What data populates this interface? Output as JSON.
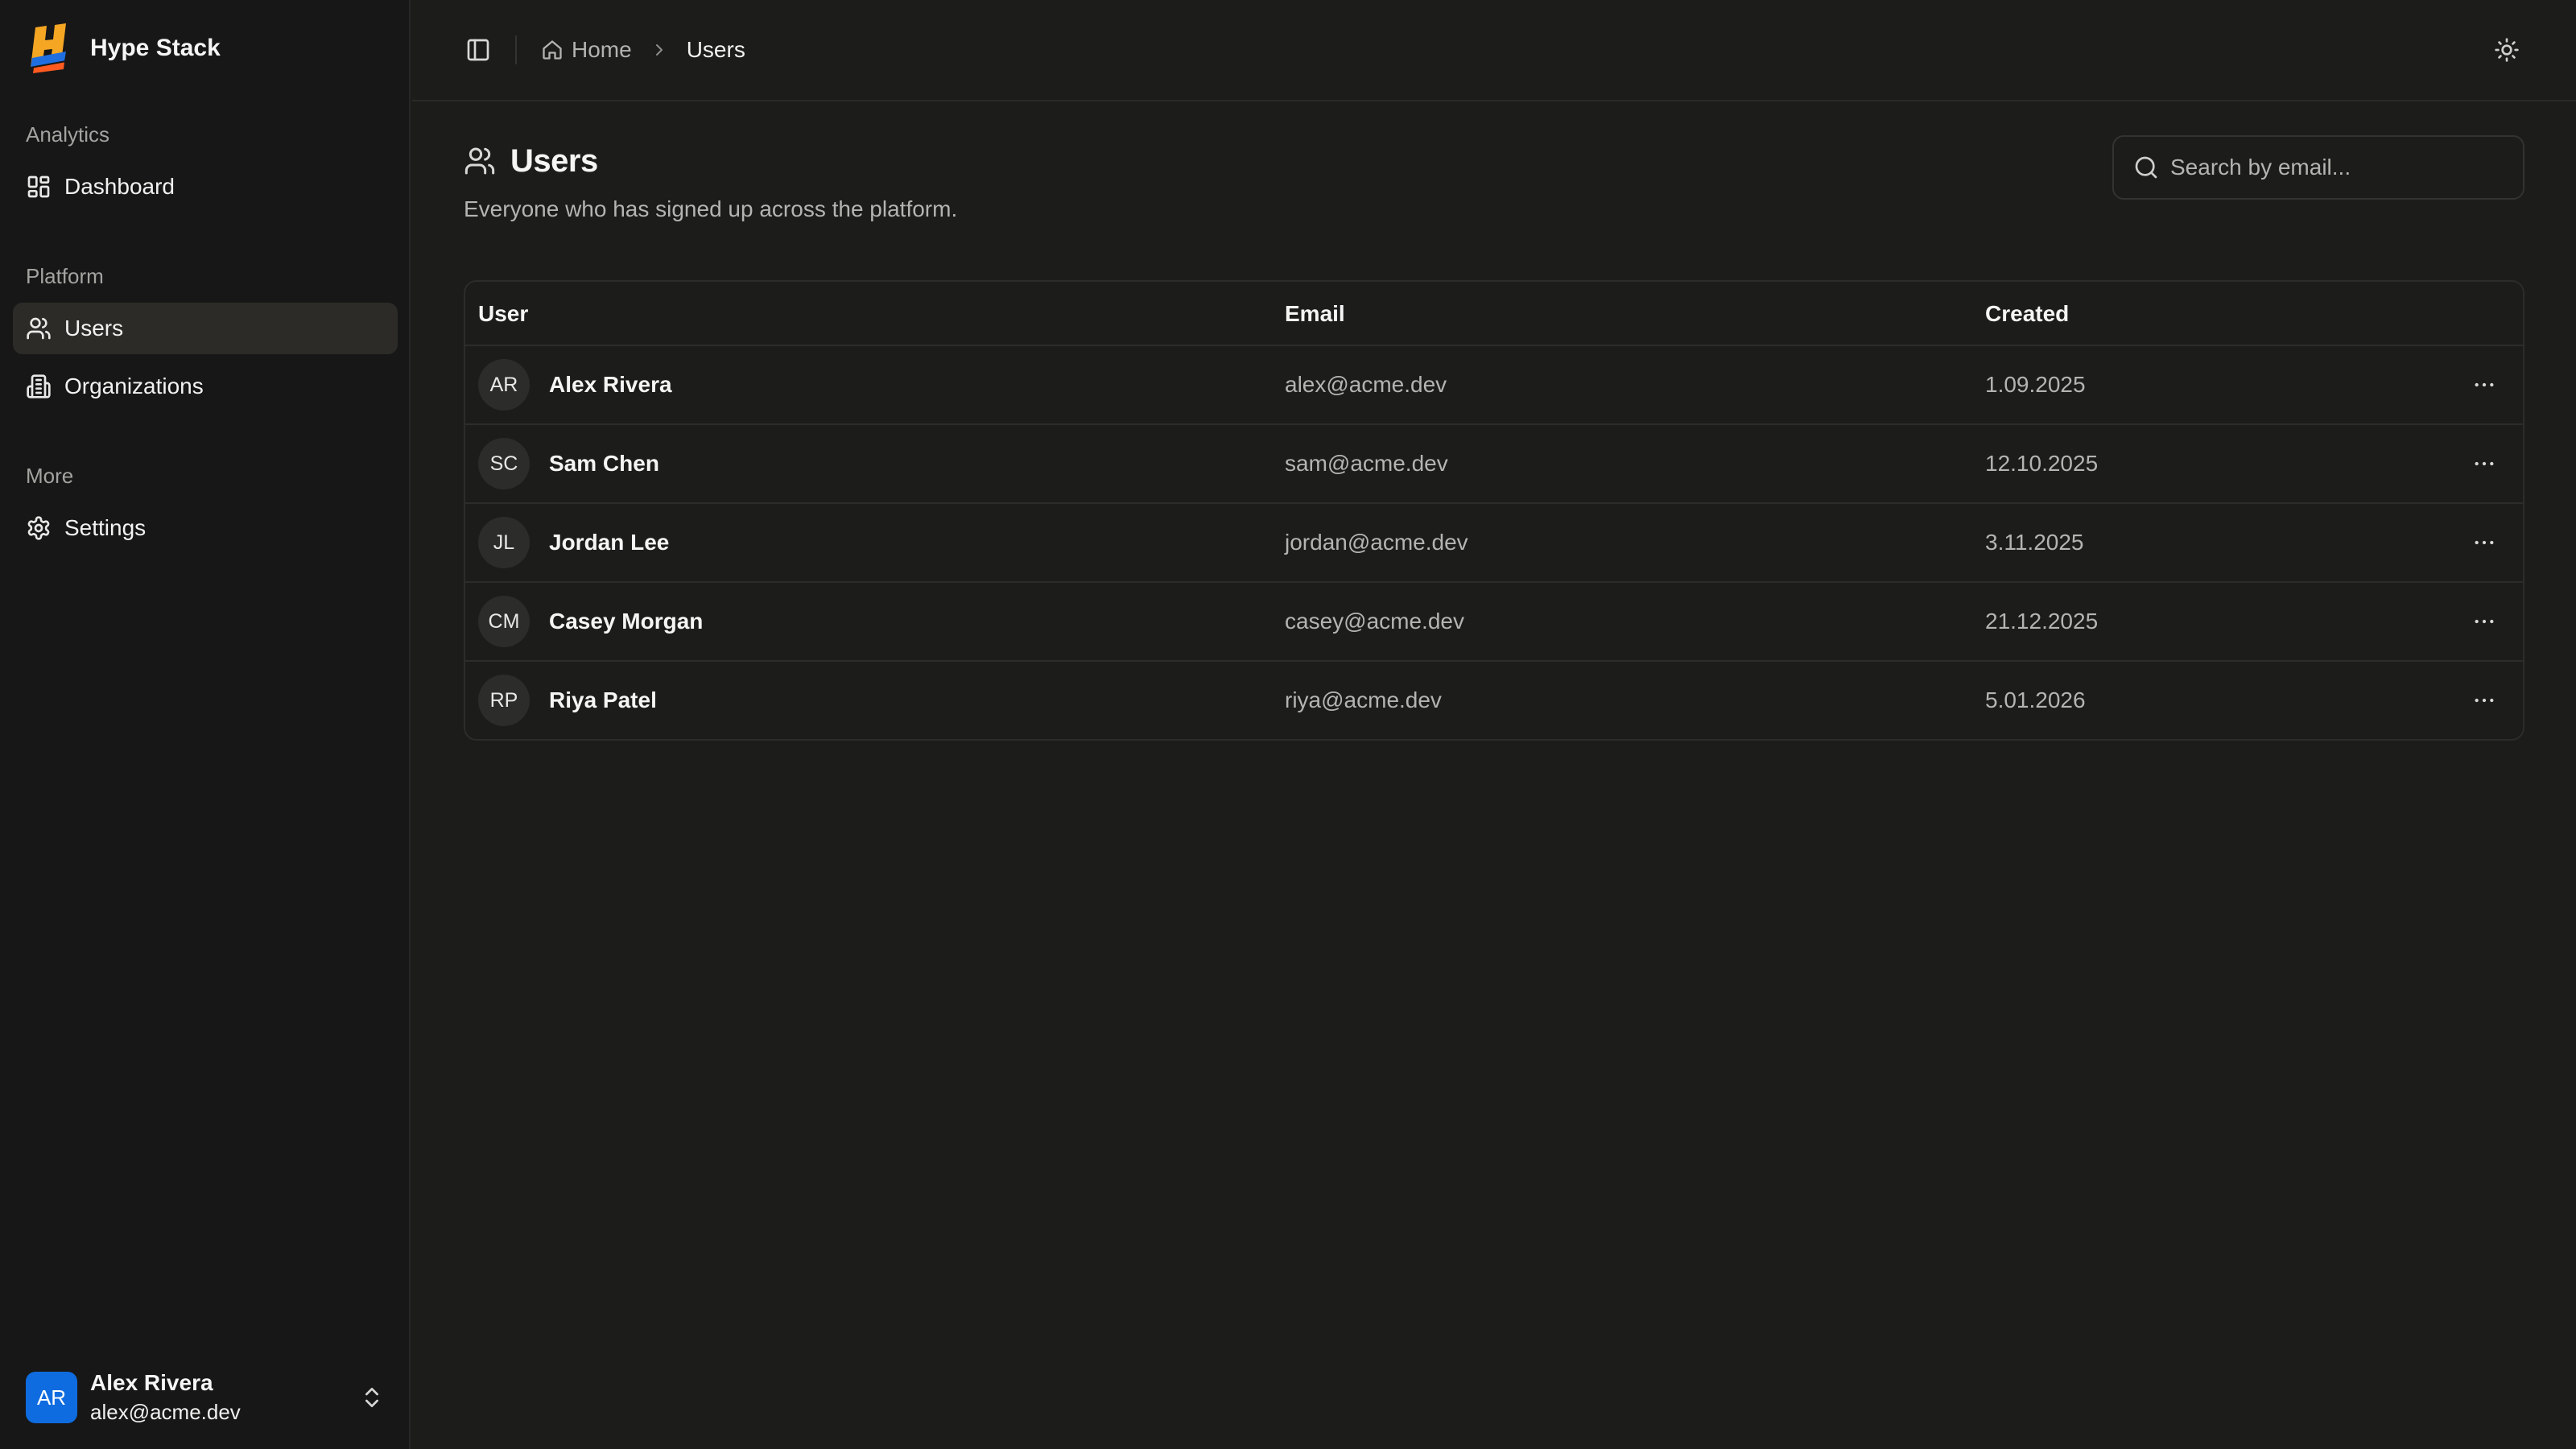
{
  "brand": {
    "name": "Hype Stack",
    "logo_letter": "H"
  },
  "sidebar": {
    "groups": [
      {
        "label": "Analytics",
        "items": [
          {
            "label": "Dashboard",
            "icon": "dashboard-icon"
          }
        ]
      },
      {
        "label": "Platform",
        "items": [
          {
            "label": "Users",
            "icon": "users-icon",
            "active": true
          },
          {
            "label": "Organizations",
            "icon": "building-icon"
          }
        ]
      },
      {
        "label": "More",
        "items": [
          {
            "label": "Settings",
            "icon": "gear-icon"
          }
        ]
      }
    ],
    "user": {
      "initials": "AR",
      "name": "Alex Rivera",
      "email": "alex@acme.dev",
      "avatar_color": "#0f6ce0"
    }
  },
  "header": {
    "breadcrumb": {
      "home": "Home",
      "current": "Users"
    }
  },
  "page": {
    "title": "Users",
    "subtitle": "Everyone who has signed up across the platform.",
    "search_placeholder": "Search by email..."
  },
  "table": {
    "columns": [
      "User",
      "Email",
      "Created"
    ],
    "rows": [
      {
        "initials": "AR",
        "name": "Alex Rivera",
        "email": "alex@acme.dev",
        "created": "1.09.2025"
      },
      {
        "initials": "SC",
        "name": "Sam Chen",
        "email": "sam@acme.dev",
        "created": "12.10.2025"
      },
      {
        "initials": "JL",
        "name": "Jordan Lee",
        "email": "jordan@acme.dev",
        "created": "3.11.2025"
      },
      {
        "initials": "CM",
        "name": "Casey Morgan",
        "email": "casey@acme.dev",
        "created": "21.12.2025"
      },
      {
        "initials": "RP",
        "name": "Riya Patel",
        "email": "riya@acme.dev",
        "created": "5.01.2026"
      }
    ]
  },
  "colors": {
    "background": "#1c1c1b",
    "sidebar": "#171717",
    "active_item": "#2c2b28",
    "avatar_blue": "#0f6ce0"
  }
}
